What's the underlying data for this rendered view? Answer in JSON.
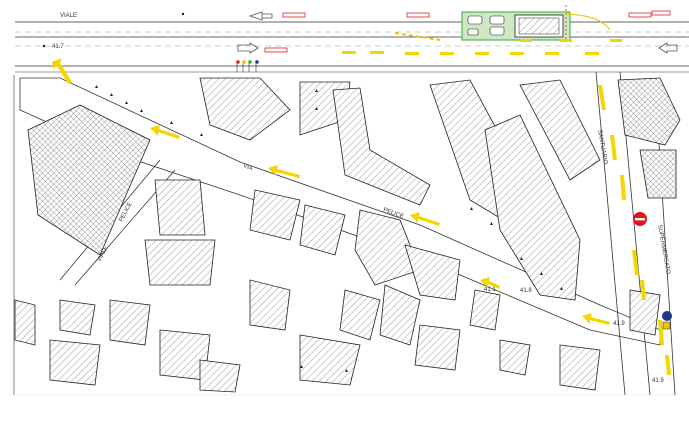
{
  "map": {
    "street_labels": {
      "viale": "VIALE",
      "pelice_1": "PELICE",
      "pelice_2": "PELICE",
      "pelice_3": "PELICE",
      "via_1": "VIA",
      "santuario": "SANTUARIO",
      "supermercato": "SUPERMERCATO",
      "viale_left": "VIALE"
    },
    "elevations": {
      "e1": "41.7",
      "e2": "41.1",
      "e3": "41.9",
      "e4": "41.9",
      "e5": "41.8"
    },
    "colors": {
      "arrow": "#f3d600",
      "no_entry": "#e0141a",
      "parking_fill": "#cfe8c4",
      "parking_stroke": "#35a83a",
      "info_sign": "#1b3a8c",
      "warning_sign": "#f3c000",
      "label_red": "#e02020"
    }
  }
}
